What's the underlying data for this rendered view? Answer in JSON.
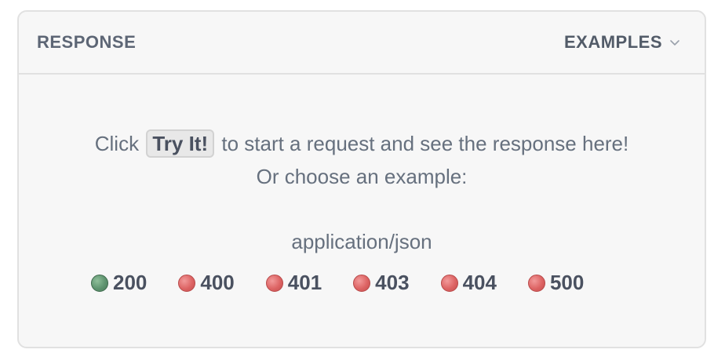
{
  "header": {
    "title": "RESPONSE",
    "examples_label": "EXAMPLES",
    "examples_icon": "chevron-down-icon"
  },
  "message": {
    "prefix": "Click",
    "button_label": "Try It!",
    "suffix": "to start a request and see the response here!",
    "line2": "Or choose an example:"
  },
  "content_type": "application/json",
  "status_codes": [
    {
      "code": "200",
      "color": "#5f9470"
    },
    {
      "code": "400",
      "color": "#dd6464"
    },
    {
      "code": "401",
      "color": "#dd6464"
    },
    {
      "code": "403",
      "color": "#dd6464"
    },
    {
      "code": "404",
      "color": "#dd6464"
    },
    {
      "code": "500",
      "color": "#dd6464"
    }
  ]
}
